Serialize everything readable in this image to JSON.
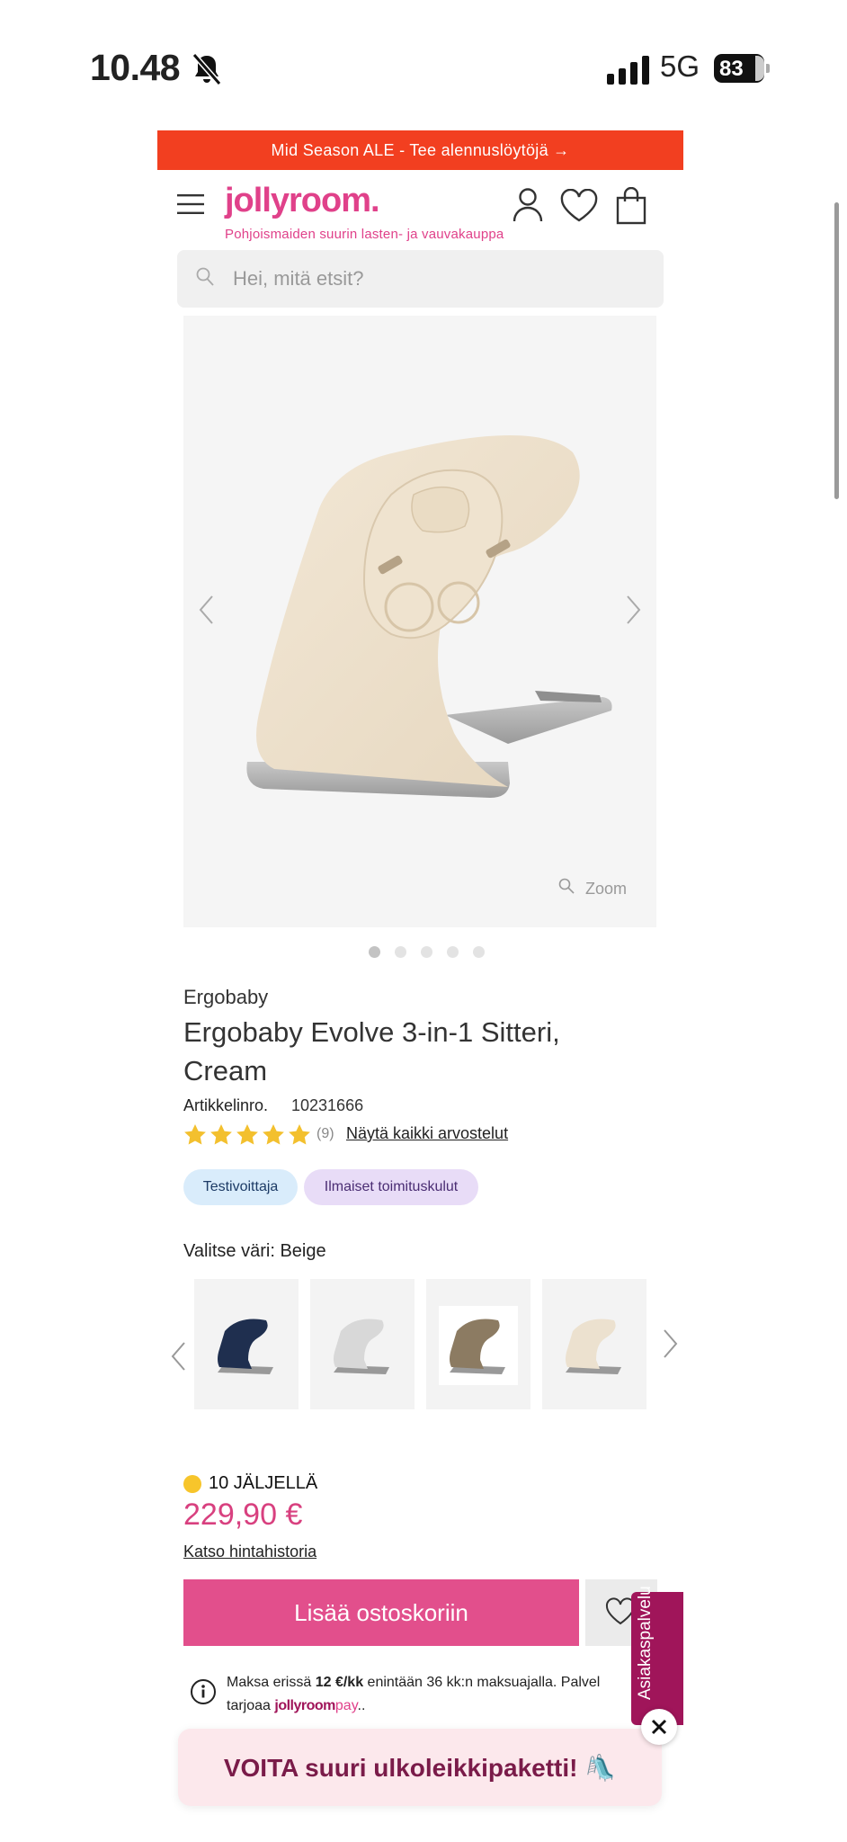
{
  "status_bar": {
    "time": "10.48",
    "network": "5G",
    "battery": "83",
    "icons": [
      "bell-muted-icon",
      "signal-icon",
      "battery-icon"
    ]
  },
  "promo": {
    "text": "Mid Season ALE - Tee alennuslöytöjä →"
  },
  "header": {
    "logo": "jollyroom.",
    "tagline": "Pohjoismaiden suurin lasten- ja vauvakauppa",
    "icons": [
      "menu-icon",
      "user-icon",
      "heart-icon",
      "shopping-bag-icon"
    ]
  },
  "search": {
    "placeholder": "Hei, mitä etsit?"
  },
  "gallery": {
    "zoom_label": "Zoom",
    "image_count": 5,
    "active_index": 0
  },
  "product": {
    "brand": "Ergobaby",
    "title": "Ergobaby Evolve 3-in-1 Sitteri, Cream",
    "article_label": "Artikkelinro.",
    "article_number": "10231666",
    "rating": 5,
    "review_count": "(9)",
    "reviews_link": "Näytä kaikki arvostelut",
    "badges": [
      "Testivoittaja",
      "Ilmaiset toimituskulut"
    ],
    "color_label": "Valitse väri: Beige",
    "stock": "10 JÄLJELLÄ",
    "price": "229,90 €",
    "price_history": "Katso hintahistoria",
    "add_to_cart": "Lisää ostoskoriin"
  },
  "colors": {
    "accent": "#e24f8c",
    "promo": "#f23f20",
    "brand": "#e0418a",
    "side_tab": "#a0155a",
    "swatches": [
      "#1f2f4f",
      "#d8d8d8",
      "#8c7b62",
      "#ece1cf"
    ]
  },
  "payment": {
    "line1_pre": "Maksa erissä ",
    "line1_amount": "12 €/kk",
    "line1_post": " enintään 36 kk:n maksuajalla. Palvel",
    "line2_pre": "tarjoaa ",
    "line2_brand": "jollyroom",
    "line2_pay": "pay",
    "line2_post": ".."
  },
  "side_tab": {
    "label": "Asiakaspalvelu"
  },
  "banner": {
    "text": "VOITA suuri ulkoleikkipaketti! 🛝"
  }
}
